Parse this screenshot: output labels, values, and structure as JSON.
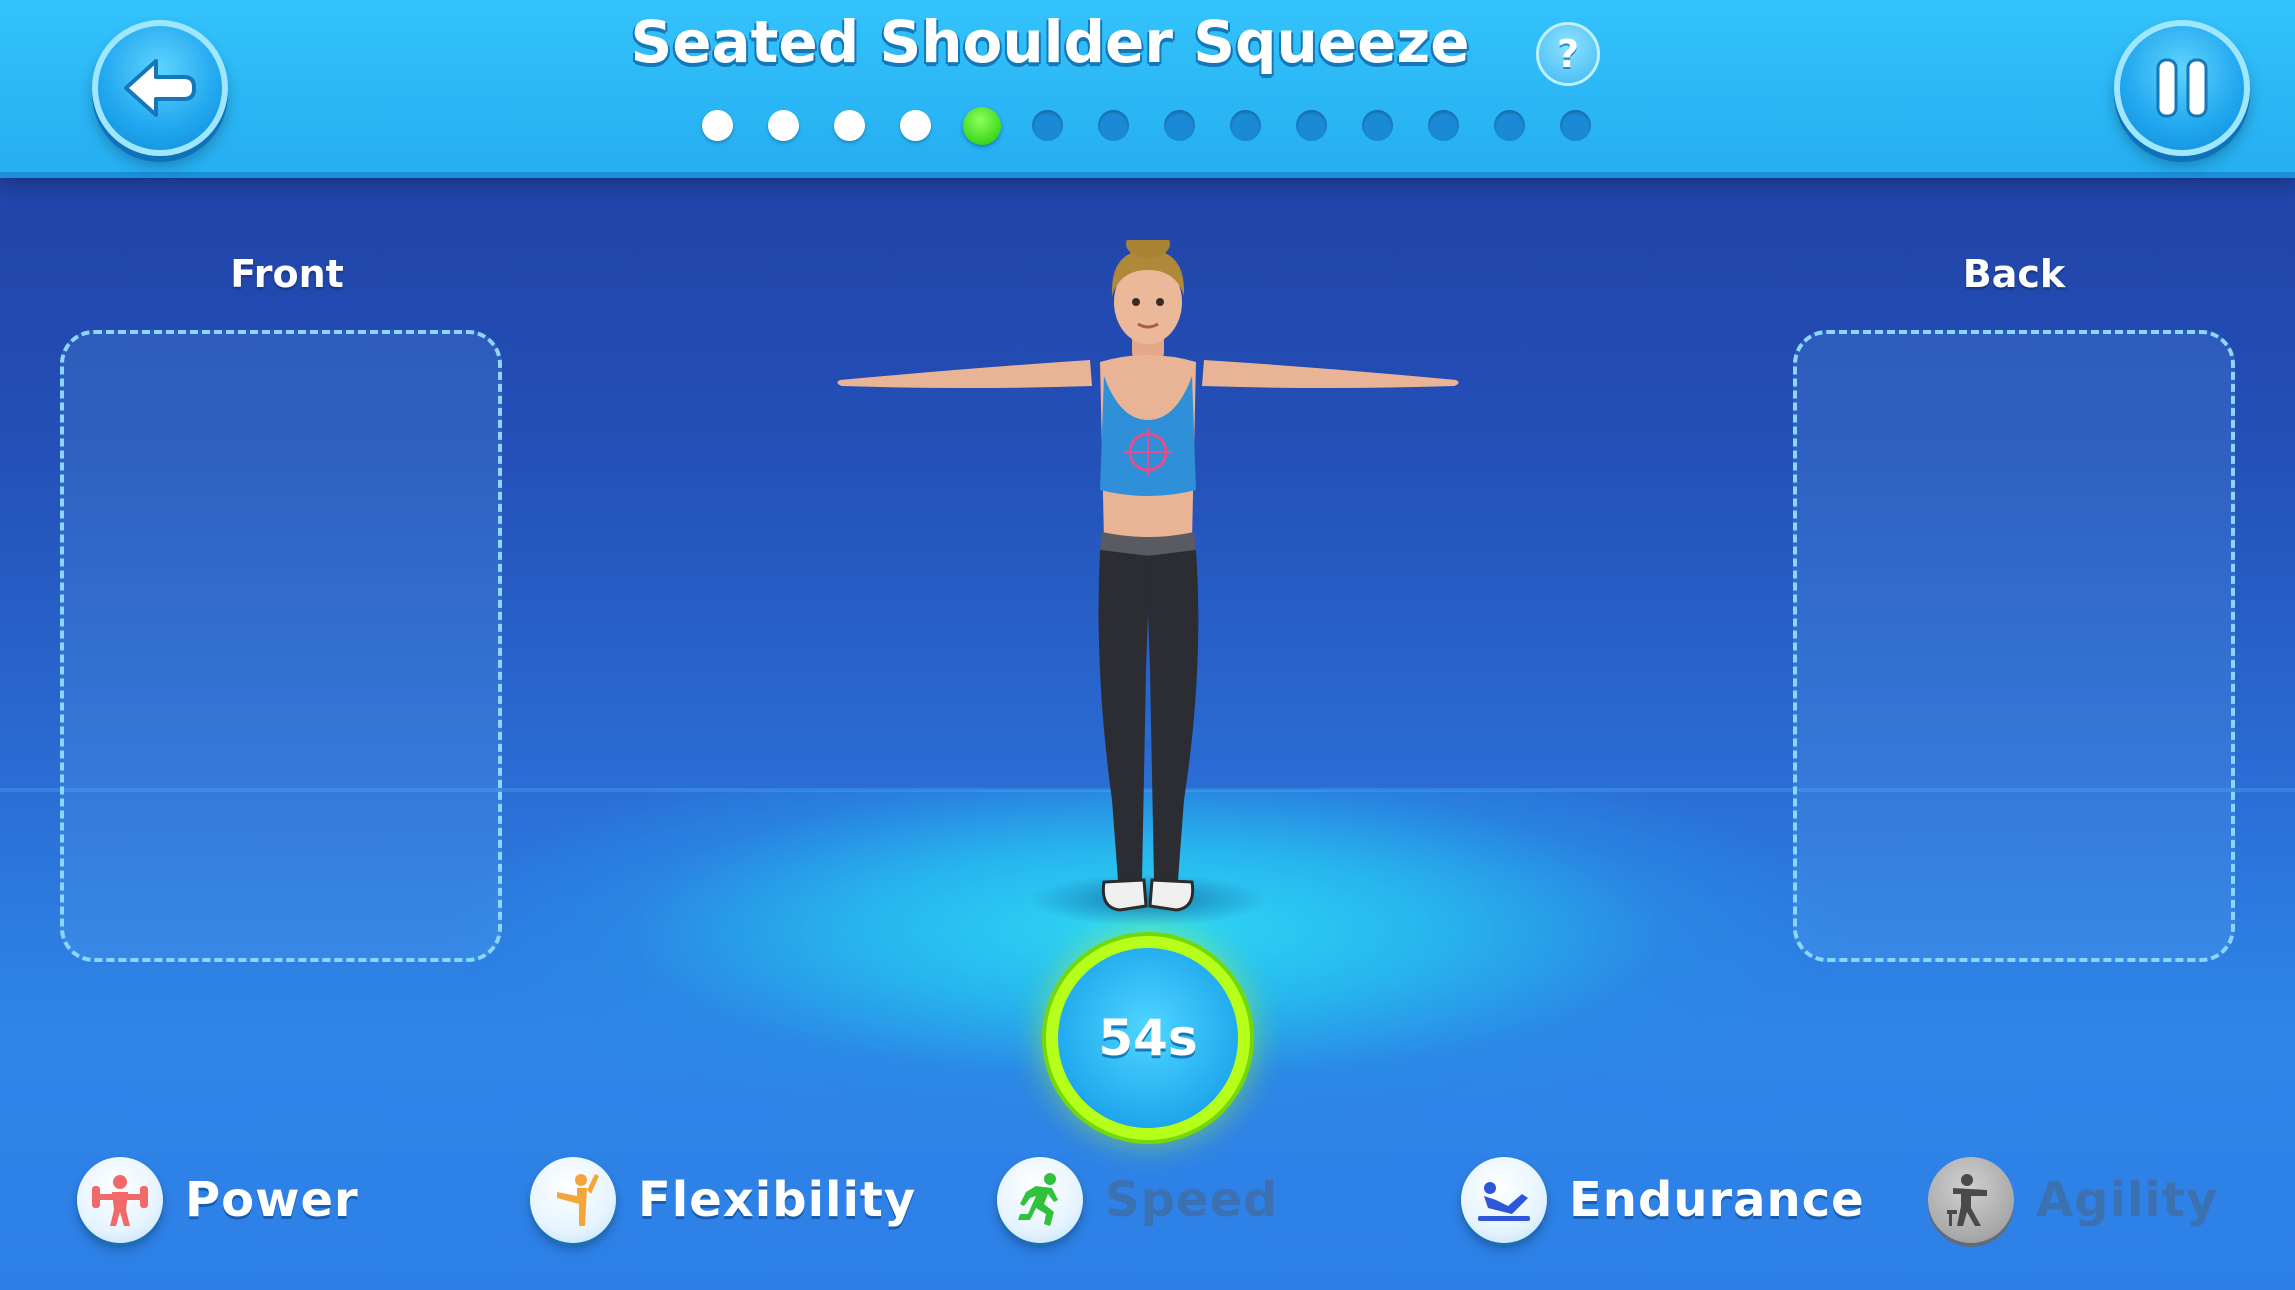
{
  "header": {
    "title": "Seated Shoulder Squeeze",
    "help_label": "?",
    "progress": {
      "total": 14,
      "completed": 4,
      "current_index": 4
    }
  },
  "panels": {
    "front_label": "Front",
    "back_label": "Back"
  },
  "timer": {
    "label": "54s"
  },
  "stats": [
    {
      "label": "Power",
      "icon": "weightlifter-icon",
      "active": true
    },
    {
      "label": "Flexibility",
      "icon": "yoga-pose-icon",
      "active": true
    },
    {
      "label": "Speed",
      "icon": "runner-icon",
      "active": false
    },
    {
      "label": "Endurance",
      "icon": "situp-icon",
      "active": true
    },
    {
      "label": "Agility",
      "icon": "hurdle-icon",
      "active": false
    }
  ],
  "colors": {
    "header": "#25aef2",
    "progress_current": "#3fd91f",
    "progress_done": "#ffffff",
    "progress_todo": "#1b8ad6",
    "timer_ring": "#b6ff1a",
    "power_icon": "#f06a6a",
    "flexibility_icon": "#f5a63a",
    "speed_icon": "#2fc23a",
    "endurance_icon": "#2d57d9",
    "agility_icon": "#5a5a5a"
  }
}
